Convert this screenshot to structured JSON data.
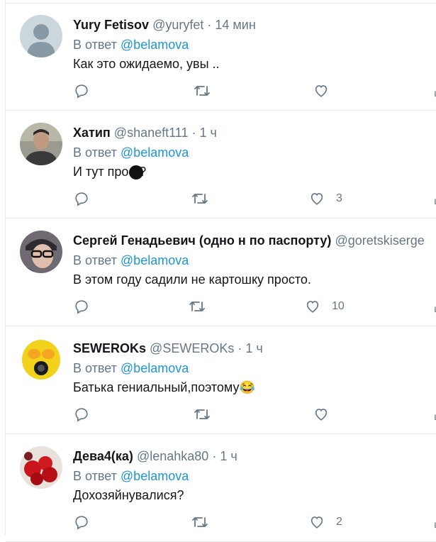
{
  "tweets": [
    {
      "name": "Yury Fetisov",
      "handle": "@yuryfet",
      "time": "14 мин",
      "reply_prefix": "В ответ",
      "reply_to": "@belamova",
      "text": "Как это ожидаемо, увы ..",
      "likes": "",
      "avatar": "default-avatar"
    },
    {
      "name": "Хатип",
      "handle": "@shaneft111",
      "time": "1 ч",
      "reply_prefix": "В ответ",
      "reply_to": "@belamova",
      "text": "И тут проф?",
      "likes": "3",
      "avatar": "photo-man"
    },
    {
      "name": "Сергей Генадьевич (одно н по паспорту)",
      "handle": "@goretskiserge",
      "time": "",
      "reply_prefix": "В ответ",
      "reply_to": "@belamova",
      "text": "В этом году садили не картошку просто.",
      "likes": "10",
      "avatar": "photo-glasses"
    },
    {
      "name": "SEWEROKs",
      "handle": "@SEWEROKs",
      "time": "1 ч",
      "reply_prefix": "В ответ",
      "reply_to": "@belamova",
      "text": "Батька гениальный,поэтому😂",
      "likes": "",
      "avatar": "yellow-gasmask"
    },
    {
      "name": "Дева4(ка)",
      "handle": "@lenahka80",
      "time": "1 ч",
      "reply_prefix": "В ответ",
      "reply_to": "@belamova",
      "text": "Дохозяйнувалися?",
      "likes": "2",
      "avatar": "red-flowers"
    }
  ],
  "icons": {
    "reply": "reply-icon",
    "retweet": "retweet-icon",
    "like": "like-icon"
  },
  "colors": {
    "mention": "#1b95e0",
    "secondary_text": "#657786",
    "border": "#e6ecf0"
  }
}
